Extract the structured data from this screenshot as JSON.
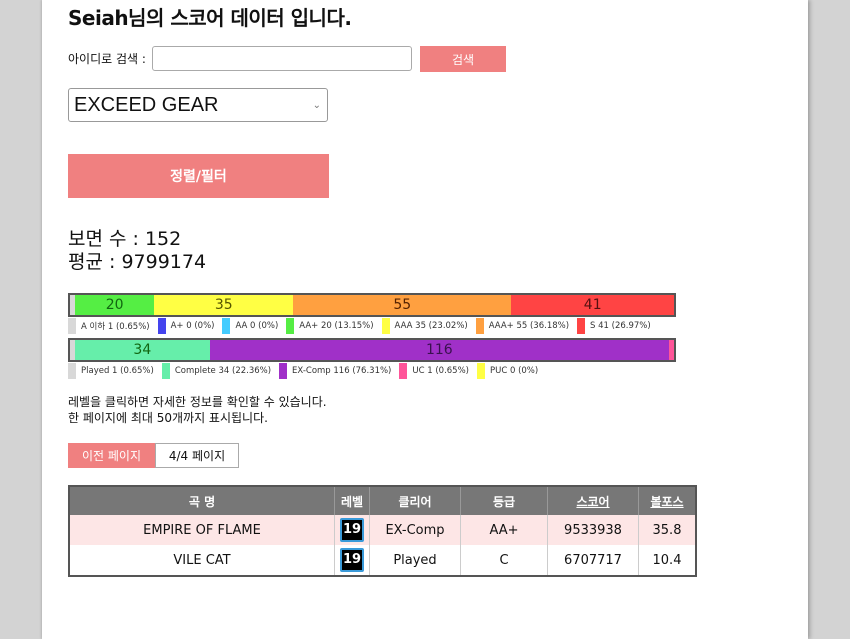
{
  "header": {
    "title": "Seiah님의 스코어 데이터 입니다."
  },
  "search": {
    "label": "아이디로 검색 :",
    "value": "",
    "placeholder": "",
    "button_label": "검색"
  },
  "game_select": {
    "selected": "EXCEED GEAR"
  },
  "filter_button_label": "정렬/필터",
  "stats": {
    "chart_count_label": "보면 수 : 152",
    "average_label": "평균 : 9799174"
  },
  "grade_bar": {
    "total": 152,
    "segments": [
      {
        "name": "A 이하",
        "count": 1,
        "pct": "0.65%",
        "color": "#d8d8d8",
        "show_label": false
      },
      {
        "name": "A+",
        "count": 0,
        "pct": "0%",
        "color": "#4444ee",
        "show_label": false
      },
      {
        "name": "AA",
        "count": 0,
        "pct": "0%",
        "color": "#44ccff",
        "show_label": false
      },
      {
        "name": "AA+",
        "count": 20,
        "pct": "13.15%",
        "color": "#55ee44",
        "show_label": true
      },
      {
        "name": "AAA",
        "count": 35,
        "pct": "23.02%",
        "color": "#ffff44",
        "show_label": true
      },
      {
        "name": "AAA+",
        "count": 55,
        "pct": "36.18%",
        "color": "#ffa040",
        "show_label": true
      },
      {
        "name": "S",
        "count": 41,
        "pct": "26.97%",
        "color": "#ff4444",
        "show_label": true
      }
    ]
  },
  "clear_bar": {
    "total": 152,
    "segments": [
      {
        "name": "Played",
        "count": 1,
        "pct": "0.65%",
        "color": "#d8d8d8",
        "show_label": false
      },
      {
        "name": "Complete",
        "count": 34,
        "pct": "22.36%",
        "color": "#66eeaa",
        "show_label": true
      },
      {
        "name": "EX-Comp",
        "count": 116,
        "pct": "76.31%",
        "color": "#a030c8",
        "show_label": true
      },
      {
        "name": "UC",
        "count": 1,
        "pct": "0.65%",
        "color": "#ff5599",
        "show_label": false
      },
      {
        "name": "PUC",
        "count": 0,
        "pct": "0%",
        "color": "#ffff44",
        "show_label": false
      }
    ]
  },
  "notice": {
    "line1": "레벨을 클릭하면 자세한 정보를 확인할 수 있습니다.",
    "line2": "한 페이지에 최대 50개까지 표시됩니다."
  },
  "pager": {
    "prev_label": "이전 페이지",
    "indicator": "4/4 페이지"
  },
  "table": {
    "headers": [
      "곡 명",
      "레벨",
      "클리어",
      "등급",
      "스코어",
      "볼포스"
    ],
    "rows": [
      {
        "title": "EMPIRE OF FLAME",
        "level": "19",
        "clear": "EX-Comp",
        "grade": "AA+",
        "score": "9533938",
        "volforce": "35.8"
      },
      {
        "title": "VILE CAT",
        "level": "19",
        "clear": "Played",
        "grade": "C",
        "score": "6707717",
        "volforce": "10.4"
      }
    ]
  }
}
